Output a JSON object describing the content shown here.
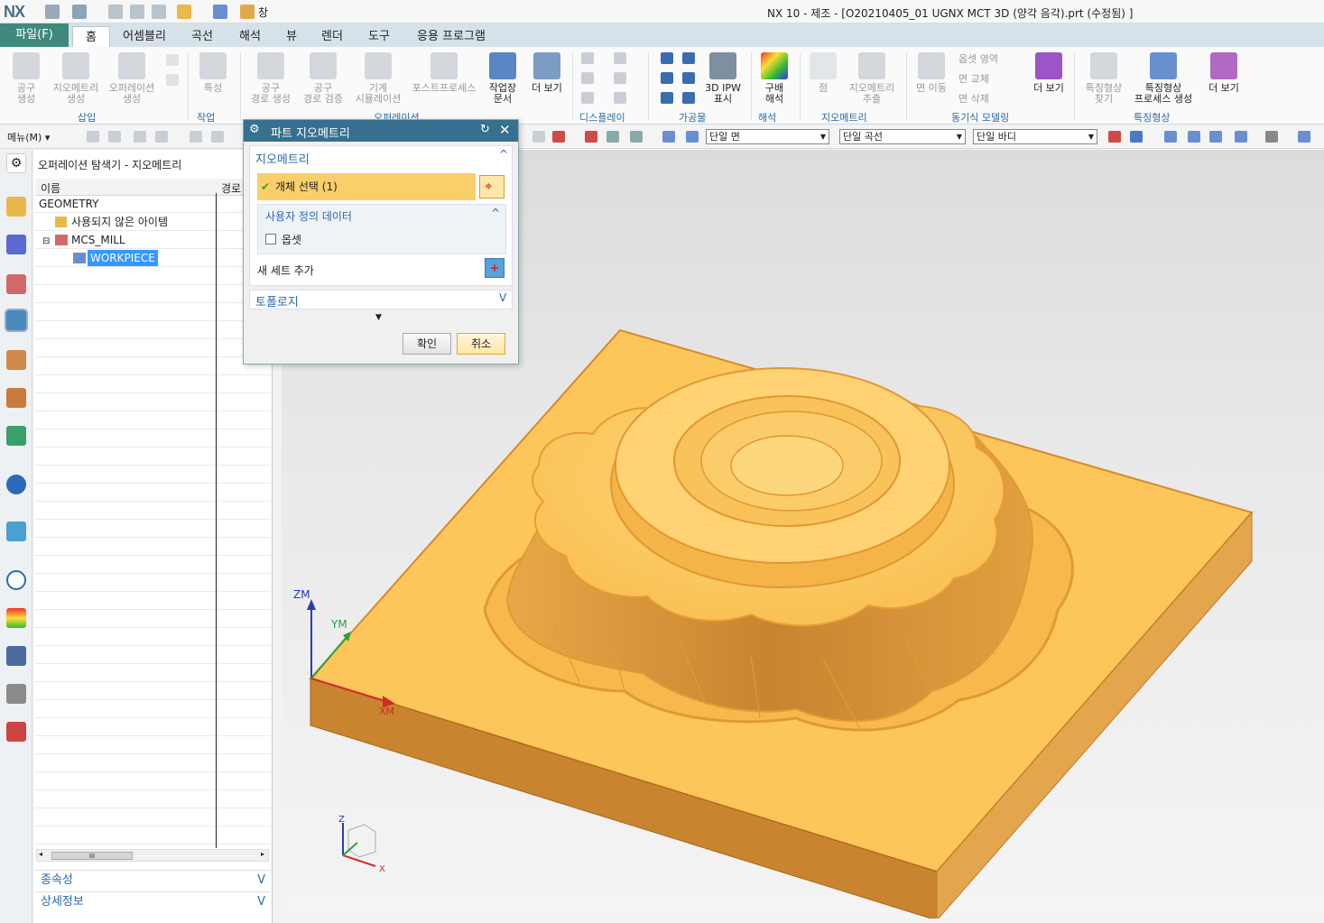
{
  "titlebar": {
    "logo": "NX",
    "title": "NX 10 - 제조 - [O20210405_01 UGNX MCT 3D (양각 음각).prt (수정됨) ]",
    "window_menu": "창"
  },
  "ribbon_tabs": [
    "파일(F)",
    "홈",
    "어셈블리",
    "곡선",
    "해석",
    "뷰",
    "렌더",
    "도구",
    "응용 프로그램"
  ],
  "ribbon": {
    "tool_create": "공구\n생성",
    "geometry_create": "지오메트리\n생성",
    "operation_create": "오퍼레이션\n생성",
    "attribute": "특성",
    "path_create": "공구\n경로 생성",
    "path_verify": "공구\n경로 검증",
    "machine_sim": "기계\n시뮬레이션",
    "postprocess": "포스트프로세스",
    "shop_doc": "작업장\n문서",
    "more1": "더 보기",
    "ipw": "3D IPW\n표시",
    "gradient": "구배\n해석",
    "point": "점",
    "geom_extract": "지오메트리\n추출",
    "offset_region": "옵셋 영역",
    "replace_face": "면 교체",
    "delete_face": "면 삭제",
    "move_face": "면 이동",
    "more2": "더 보기",
    "feature_find": "특징형상\n찾기",
    "feature_proc": "특징형상\n프로세스 생성",
    "more3": "더 보기",
    "groups": {
      "insert": "삽입",
      "work": "작업",
      "operation": "오퍼레이션",
      "display": "디스플레이",
      "workpiece": "가공물",
      "analysis": "해석",
      "geometry": "지오메트리",
      "sync": "동기식 모델링",
      "feature": "특징형상"
    }
  },
  "toolbar2": {
    "menu": "메뉴(M)",
    "filter1": "단일 면",
    "filter2": "단일 곡선",
    "filter3": "단일 바디"
  },
  "navigator": {
    "title": "오퍼레이션 탐색기 - 지오메트리",
    "col_name": "이름",
    "col_path": "경로",
    "rows": [
      "GEOMETRY",
      "사용되지 않은 아이템",
      "MCS_MILL",
      "WORKPIECE"
    ],
    "scroll_mark": "III",
    "acc_dependency": "종속성",
    "acc_detail": "상세정보"
  },
  "dialog": {
    "title": "파트 지오메트리",
    "section_geometry": "지오메트리",
    "select_object": "개체 선택 (1)",
    "user_defined": "사용자 정의 데이터",
    "offset": "옵셋",
    "add_set": "새 세트 추가",
    "section_topology": "토폴로지",
    "ok": "확인",
    "cancel": "취소"
  },
  "axes": {
    "zm": "ZM",
    "ym": "YM",
    "xm": "XM",
    "z": "Z",
    "x": "X"
  },
  "colors": {
    "part_top": "#fcc65a",
    "part_side": "#c8842f",
    "accent": "#37708f",
    "file_tab": "#3f8a7d"
  }
}
